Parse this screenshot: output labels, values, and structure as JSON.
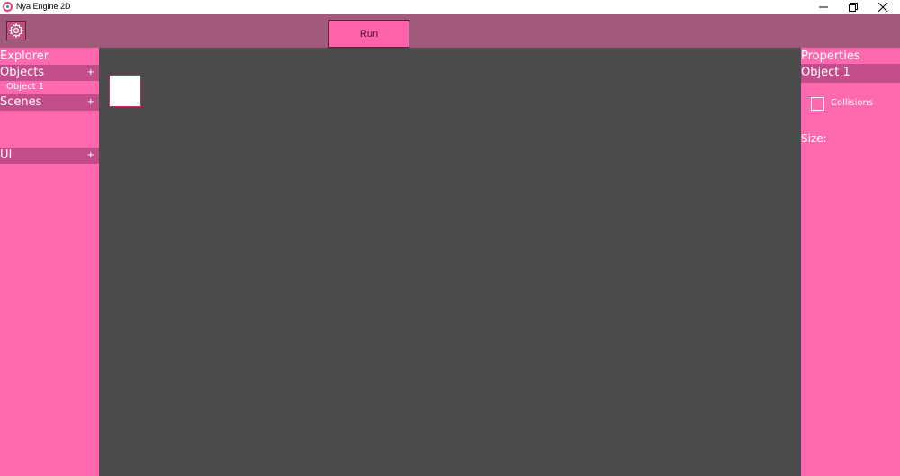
{
  "window": {
    "title": "Nya Engine 2D",
    "icon": "app-logo-icon",
    "controls": [
      "minimize-icon",
      "maximize-icon",
      "close-icon"
    ]
  },
  "toolbar": {
    "settings_icon": "gear-icon",
    "run_label": "Run"
  },
  "explorer": {
    "title": "Explorer",
    "objects": {
      "label": "Objects",
      "add": "+",
      "items": [
        "Object 1"
      ]
    },
    "scenes": {
      "label": "Scenes",
      "add": "+"
    },
    "ui": {
      "label": "UI",
      "add": "+"
    }
  },
  "properties": {
    "title": "Properties",
    "selected": "Object 1",
    "collisions_label": "Collisions",
    "collisions_checked": false,
    "size_label": "Size:"
  },
  "colors": {
    "toolbar": "#a25a7a",
    "panel": "#ff6aae",
    "section_header": "#c34d8b",
    "viewport": "#4b4b4b",
    "run_button": "#ff63ac"
  }
}
